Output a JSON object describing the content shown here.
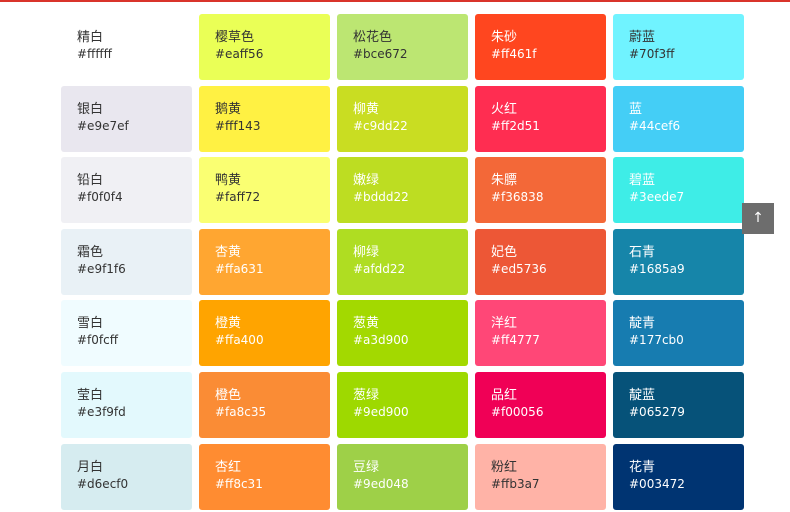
{
  "colors": [
    {
      "name": "精白",
      "hex": "#ffffff"
    },
    {
      "name": "樱草色",
      "hex": "#eaff56"
    },
    {
      "name": "松花色",
      "hex": "#bce672"
    },
    {
      "name": "朱砂",
      "hex": "#ff461f"
    },
    {
      "name": "蔚蓝",
      "hex": "#70f3ff"
    },
    {
      "name": "银白",
      "hex": "#e9e7ef"
    },
    {
      "name": "鹅黄",
      "hex": "#fff143"
    },
    {
      "name": "柳黄",
      "hex": "#c9dd22"
    },
    {
      "name": "火红",
      "hex": "#ff2d51"
    },
    {
      "name": "蓝",
      "hex": "#44cef6"
    },
    {
      "name": "铅白",
      "hex": "#f0f0f4"
    },
    {
      "name": "鸭黄",
      "hex": "#faff72"
    },
    {
      "name": "嫩绿",
      "hex": "#bddd22"
    },
    {
      "name": "朱膘",
      "hex": "#f36838"
    },
    {
      "name": "碧蓝",
      "hex": "#3eede7"
    },
    {
      "name": "霜色",
      "hex": "#e9f1f6"
    },
    {
      "name": "杏黄",
      "hex": "#ffa631"
    },
    {
      "name": "柳绿",
      "hex": "#afdd22"
    },
    {
      "name": "妃色",
      "hex": "#ed5736"
    },
    {
      "name": "石青",
      "hex": "#1685a9"
    },
    {
      "name": "雪白",
      "hex": "#f0fcff"
    },
    {
      "name": "橙黄",
      "hex": "#ffa400"
    },
    {
      "name": "葱黄",
      "hex": "#a3d900"
    },
    {
      "name": "洋红",
      "hex": "#ff4777"
    },
    {
      "name": "靛青",
      "hex": "#177cb0"
    },
    {
      "name": "莹白",
      "hex": "#e3f9fd"
    },
    {
      "name": "橙色",
      "hex": "#fa8c35"
    },
    {
      "name": "葱绿",
      "hex": "#9ed900"
    },
    {
      "name": "品红",
      "hex": "#f00056"
    },
    {
      "name": "靛蓝",
      "hex": "#065279"
    },
    {
      "name": "月白",
      "hex": "#d6ecf0"
    },
    {
      "name": "杏红",
      "hex": "#ff8c31"
    },
    {
      "name": "豆绿",
      "hex": "#9ed048"
    },
    {
      "name": "粉红",
      "hex": "#ffb3a7"
    },
    {
      "name": "花青",
      "hex": "#003472"
    }
  ],
  "back_to_top": {
    "label": "↑"
  }
}
